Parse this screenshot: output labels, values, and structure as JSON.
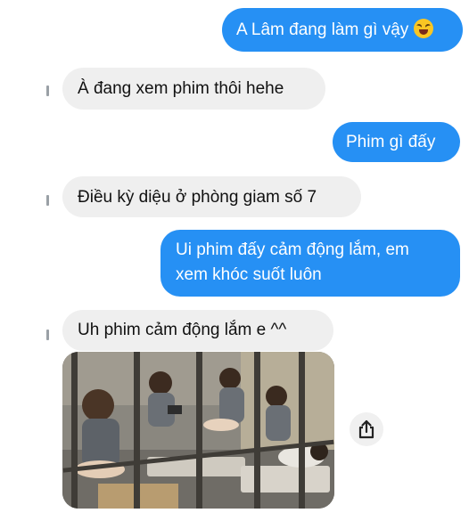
{
  "messages": [
    {
      "side": "sent",
      "text": "A Lâm đang làm gì vậy",
      "emoji": "grinning-squint-emoji"
    },
    {
      "side": "received",
      "text": "À đang xem phim thôi hehe"
    },
    {
      "side": "sent",
      "text": "Phim gì đấy"
    },
    {
      "side": "received",
      "text": "Điều kỳ diệu ở phòng giam số 7"
    },
    {
      "side": "sent",
      "lines": [
        "Ui phim đấy cảm động lắm, em",
        "xem khóc suốt luôn"
      ]
    },
    {
      "side": "received",
      "text": "Uh phim cảm động lắm e ^^"
    }
  ],
  "photo": {
    "description_icon": "movie-still-photo"
  },
  "share": {
    "icon": "share-icon"
  },
  "colors": {
    "sent_bubble": "#2690f4",
    "received_bubble": "#efefef",
    "background": "#ffffff"
  }
}
